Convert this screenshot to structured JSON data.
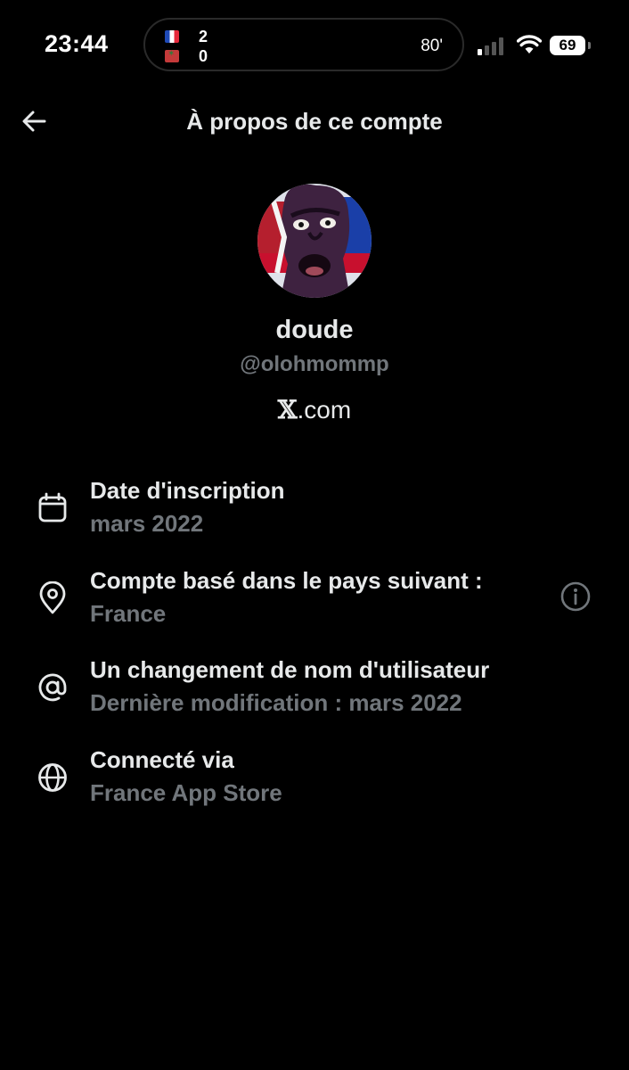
{
  "status_bar": {
    "time": "23:44",
    "live_activity": {
      "team_a_flag": "flag-france-icon",
      "team_a_score": "2",
      "team_b_flag": "flag-morocco-icon",
      "team_b_score": "0",
      "minute": "80'"
    },
    "battery": "69"
  },
  "header": {
    "title": "À propos de ce compte"
  },
  "profile": {
    "name": "doude",
    "handle": "@olohmommp",
    "site_logo": "𝕏",
    "site_suffix": ".com"
  },
  "info": [
    {
      "icon": "calendar-icon",
      "title": "Date d'inscription",
      "value": "mars 2022"
    },
    {
      "icon": "location-pin-icon",
      "title": "Compte basé dans le pays suivant :",
      "value": "France",
      "action_icon": "info-icon"
    },
    {
      "icon": "at-sign-icon",
      "title": "Un changement de nom d'utilisateur",
      "value": "Dernière modification : mars 2022"
    },
    {
      "icon": "globe-icon",
      "title": "Connecté via",
      "value": "France App Store"
    }
  ],
  "colors": {
    "background": "#000000",
    "primary_text": "#e7e9ea",
    "secondary_text": "#71767b"
  }
}
